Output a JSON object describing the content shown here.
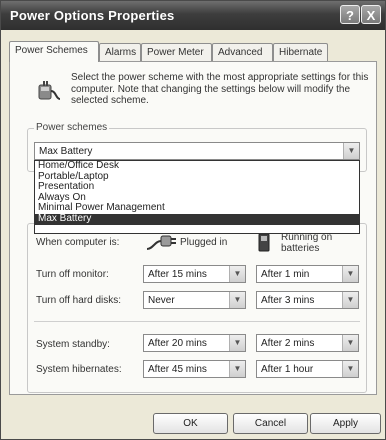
{
  "window": {
    "title": "Power Options Properties",
    "help_label": "?",
    "close_label": "X"
  },
  "tabs": [
    {
      "label": "Power Schemes"
    },
    {
      "label": "Alarms"
    },
    {
      "label": "Power Meter"
    },
    {
      "label": "Advanced"
    },
    {
      "label": "Hibernate"
    }
  ],
  "description": "Select the power scheme with the most appropriate settings for this computer. Note that changing the settings below will modify the selected scheme.",
  "power_schemes": {
    "legend": "Power schemes",
    "selected": "Max Battery",
    "options": [
      "Home/Office Desk",
      "Portable/Laptop",
      "Presentation",
      "Always On",
      "Minimal Power Management",
      "Max Battery"
    ]
  },
  "settings": {
    "when_label": "When computer is:",
    "plugged_in": "Plugged in",
    "on_batteries": "Running on batteries",
    "rows": [
      {
        "label": "Turn off monitor:",
        "plugged": "After 15 mins",
        "battery": "After 1 min"
      },
      {
        "label": "Turn off hard disks:",
        "plugged": "Never",
        "battery": "After 3 mins"
      },
      {
        "label": "System standby:",
        "plugged": "After 20 mins",
        "battery": "After 2 mins"
      },
      {
        "label": "System hibernates:",
        "plugged": "After 45 mins",
        "battery": "After 1 hour"
      }
    ]
  },
  "buttons": {
    "ok": "OK",
    "cancel": "Cancel",
    "apply": "Apply"
  }
}
